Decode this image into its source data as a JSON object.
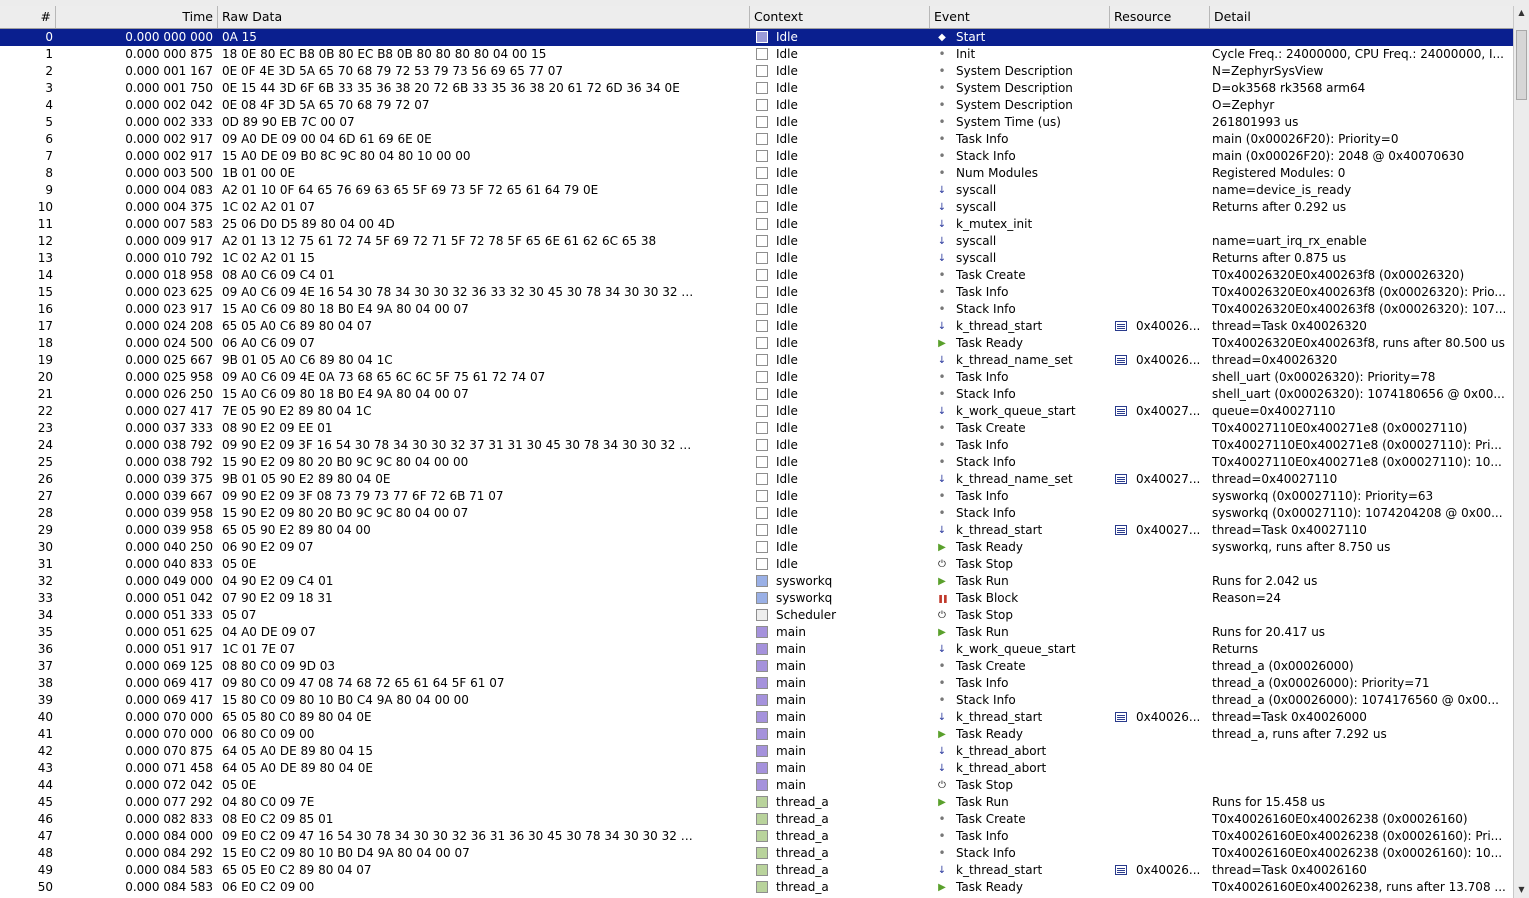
{
  "columns": {
    "num": "#",
    "time": "Time",
    "raw": "Raw Data",
    "context": "Context",
    "event": "Event",
    "resource": "Resource",
    "detail": "Detail"
  },
  "colors": {
    "selected": "#0a1f8f",
    "idle": "#ffffff",
    "scheduler": "#eeeeee",
    "sysworkq": "#9ab0e6",
    "main": "#a592dc",
    "thread_a": "#b9d39c"
  },
  "scroll": {
    "up": "▲",
    "down": "▼"
  },
  "rows": [
    {
      "n": "0",
      "t": "0.000 000 000",
      "r": "0A 15",
      "ctx": "Idle",
      "sw": "#9a9ad8",
      "ev": "Start",
      "ic": "◆",
      "res": "",
      "d": ""
    },
    {
      "n": "1",
      "t": "0.000 000 875",
      "r": "18 0E 80 EC B8 0B 80 EC B8 0B 80 80 80 80 04 00 15",
      "ctx": "Idle",
      "sw": "#ffffff",
      "ev": "Init",
      "ic": "•",
      "res": "",
      "d": "Cycle Freq.: 24000000, CPU Freq.: 24000000, I..."
    },
    {
      "n": "2",
      "t": "0.000 001 167",
      "r": "0E 0F 4E 3D 5A 65 70 68 79 72 53 79 73 56 69 65 77 07",
      "ctx": "Idle",
      "sw": "#ffffff",
      "ev": "System Description",
      "ic": "•",
      "res": "",
      "d": "N=ZephyrSysView"
    },
    {
      "n": "3",
      "t": "0.000 001 750",
      "r": "0E 15 44 3D 6F 6B 33 35 36 38 20 72 6B 33 35 36 38 20 61 72 6D 36 34 0E",
      "ctx": "Idle",
      "sw": "#ffffff",
      "ev": "System Description",
      "ic": "•",
      "res": "",
      "d": "D=ok3568 rk3568 arm64"
    },
    {
      "n": "4",
      "t": "0.000 002 042",
      "r": "0E 08 4F 3D 5A 65 70 68 79 72 07",
      "ctx": "Idle",
      "sw": "#ffffff",
      "ev": "System Description",
      "ic": "•",
      "res": "",
      "d": "O=Zephyr"
    },
    {
      "n": "5",
      "t": "0.000 002 333",
      "r": "0D 89 90 EB 7C 00 07",
      "ctx": "Idle",
      "sw": "#ffffff",
      "ev": "System Time (us)",
      "ic": "•",
      "res": "",
      "d": "261801993 us"
    },
    {
      "n": "6",
      "t": "0.000 002 917",
      "r": "09 A0 DE 09 00 04 6D 61 69 6E 0E",
      "ctx": "Idle",
      "sw": "#ffffff",
      "ev": "Task Info",
      "ic": "•",
      "res": "",
      "d": "main (0x00026F20): Priority=0"
    },
    {
      "n": "7",
      "t": "0.000 002 917",
      "r": "15 A0 DE 09 B0 8C 9C 80 04 80 10 00 00",
      "ctx": "Idle",
      "sw": "#ffffff",
      "ev": "Stack Info",
      "ic": "•",
      "res": "",
      "d": "main (0x00026F20): 2048 @ 0x40070630"
    },
    {
      "n": "8",
      "t": "0.000 003 500",
      "r": "1B 01 00 0E",
      "ctx": "Idle",
      "sw": "#ffffff",
      "ev": "Num Modules",
      "ic": "•",
      "res": "",
      "d": "Registered Modules: 0"
    },
    {
      "n": "9",
      "t": "0.000 004 083",
      "r": "A2 01 10 0F 64 65 76 69 63 65 5F 69 73 5F 72 65 61 64 79 0E",
      "ctx": "Idle",
      "sw": "#ffffff",
      "ev": "syscall",
      "ic": "↓",
      "res": "",
      "d": "name=device_is_ready"
    },
    {
      "n": "10",
      "t": "0.000 004 375",
      "r": "1C 02 A2 01 07",
      "ctx": "Idle",
      "sw": "#ffffff",
      "ev": "syscall",
      "ic": "↓",
      "res": "",
      "d": "Returns after 0.292 us"
    },
    {
      "n": "11",
      "t": "0.000 007 583",
      "r": "25 06 D0 D5 89 80 04 00 4D",
      "ctx": "Idle",
      "sw": "#ffffff",
      "ev": "k_mutex_init",
      "ic": "↓",
      "res": "",
      "d": ""
    },
    {
      "n": "12",
      "t": "0.000 009 917",
      "r": "A2 01 13 12 75 61 72 74 5F 69 72 71 5F 72 78 5F 65 6E 61 62 6C 65 38",
      "ctx": "Idle",
      "sw": "#ffffff",
      "ev": "syscall",
      "ic": "↓",
      "res": "",
      "d": "name=uart_irq_rx_enable"
    },
    {
      "n": "13",
      "t": "0.000 010 792",
      "r": "1C 02 A2 01 15",
      "ctx": "Idle",
      "sw": "#ffffff",
      "ev": "syscall",
      "ic": "↓",
      "res": "",
      "d": "Returns after 0.875 us"
    },
    {
      "n": "14",
      "t": "0.000 018 958",
      "r": "08 A0 C6 09 C4 01",
      "ctx": "Idle",
      "sw": "#ffffff",
      "ev": "Task Create",
      "ic": "•",
      "res": "",
      "d": "T0x40026320E0x400263f8 (0x00026320)"
    },
    {
      "n": "15",
      "t": "0.000 023 625",
      "r": "09 A0 C6 09 4E 16 54 30 78 34 30 30 32 36 33 32 30 45 30 78 34 30 30 32 …",
      "ctx": "Idle",
      "sw": "#ffffff",
      "ev": "Task Info",
      "ic": "•",
      "res": "",
      "d": "T0x40026320E0x400263f8 (0x00026320): Prio..."
    },
    {
      "n": "16",
      "t": "0.000 023 917",
      "r": "15 A0 C6 09 80 18 B0 E4 9A 80 04 00 07",
      "ctx": "Idle",
      "sw": "#ffffff",
      "ev": "Stack Info",
      "ic": "•",
      "res": "",
      "d": "T0x40026320E0x400263f8 (0x00026320): 107..."
    },
    {
      "n": "17",
      "t": "0.000 024 208",
      "r": "65 05 A0 C6 89 80 04 07",
      "ctx": "Idle",
      "sw": "#ffffff",
      "ev": "k_thread_start",
      "ic": "↓",
      "res": "0x40026...",
      "d": "thread=Task 0x40026320"
    },
    {
      "n": "18",
      "t": "0.000 024 500",
      "r": "06 A0 C6 09 07",
      "ctx": "Idle",
      "sw": "#ffffff",
      "ev": "Task Ready",
      "ic": "▶",
      "res": "",
      "d": "T0x40026320E0x400263f8, runs after 80.500 us"
    },
    {
      "n": "19",
      "t": "0.000 025 667",
      "r": "9B 01 05 A0 C6 89 80 04 1C",
      "ctx": "Idle",
      "sw": "#ffffff",
      "ev": "k_thread_name_set",
      "ic": "↓",
      "res": "0x40026...",
      "d": "thread=0x40026320"
    },
    {
      "n": "20",
      "t": "0.000 025 958",
      "r": "09 A0 C6 09 4E 0A 73 68 65 6C 6C 5F 75 61 72 74 07",
      "ctx": "Idle",
      "sw": "#ffffff",
      "ev": "Task Info",
      "ic": "•",
      "res": "",
      "d": "shell_uart (0x00026320): Priority=78"
    },
    {
      "n": "21",
      "t": "0.000 026 250",
      "r": "15 A0 C6 09 80 18 B0 E4 9A 80 04 00 07",
      "ctx": "Idle",
      "sw": "#ffffff",
      "ev": "Stack Info",
      "ic": "•",
      "res": "",
      "d": "shell_uart (0x00026320): 1074180656 @ 0x00..."
    },
    {
      "n": "22",
      "t": "0.000 027 417",
      "r": "7E 05 90 E2 89 80 04 1C",
      "ctx": "Idle",
      "sw": "#ffffff",
      "ev": "k_work_queue_start",
      "ic": "↓",
      "res": "0x40027...",
      "d": "queue=0x40027110"
    },
    {
      "n": "23",
      "t": "0.000 037 333",
      "r": "08 90 E2 09 EE 01",
      "ctx": "Idle",
      "sw": "#ffffff",
      "ev": "Task Create",
      "ic": "•",
      "res": "",
      "d": "T0x40027110E0x400271e8 (0x00027110)"
    },
    {
      "n": "24",
      "t": "0.000 038 792",
      "r": "09 90 E2 09 3F 16 54 30 78 34 30 30 32 37 31 31 30 45 30 78 34 30 30 32 …",
      "ctx": "Idle",
      "sw": "#ffffff",
      "ev": "Task Info",
      "ic": "•",
      "res": "",
      "d": "T0x40027110E0x400271e8 (0x00027110): Pri..."
    },
    {
      "n": "25",
      "t": "0.000 038 792",
      "r": "15 90 E2 09 80 20 B0 9C 9C 80 04 00 00",
      "ctx": "Idle",
      "sw": "#ffffff",
      "ev": "Stack Info",
      "ic": "•",
      "res": "",
      "d": "T0x40027110E0x400271e8 (0x00027110): 10..."
    },
    {
      "n": "26",
      "t": "0.000 039 375",
      "r": "9B 01 05 90 E2 89 80 04 0E",
      "ctx": "Idle",
      "sw": "#ffffff",
      "ev": "k_thread_name_set",
      "ic": "↓",
      "res": "0x40027...",
      "d": "thread=0x40027110"
    },
    {
      "n": "27",
      "t": "0.000 039 667",
      "r": "09 90 E2 09 3F 08 73 79 73 77 6F 72 6B 71 07",
      "ctx": "Idle",
      "sw": "#ffffff",
      "ev": "Task Info",
      "ic": "•",
      "res": "",
      "d": "sysworkq (0x00027110): Priority=63"
    },
    {
      "n": "28",
      "t": "0.000 039 958",
      "r": "15 90 E2 09 80 20 B0 9C 9C 80 04 00 07",
      "ctx": "Idle",
      "sw": "#ffffff",
      "ev": "Stack Info",
      "ic": "•",
      "res": "",
      "d": "sysworkq (0x00027110): 1074204208 @ 0x00..."
    },
    {
      "n": "29",
      "t": "0.000 039 958",
      "r": "65 05 90 E2 89 80 04 00",
      "ctx": "Idle",
      "sw": "#ffffff",
      "ev": "k_thread_start",
      "ic": "↓",
      "res": "0x40027...",
      "d": "thread=Task 0x40027110"
    },
    {
      "n": "30",
      "t": "0.000 040 250",
      "r": "06 90 E2 09 07",
      "ctx": "Idle",
      "sw": "#ffffff",
      "ev": "Task Ready",
      "ic": "▶",
      "res": "",
      "d": "sysworkq, runs after 8.750 us"
    },
    {
      "n": "31",
      "t": "0.000 040 833",
      "r": "05 0E",
      "ctx": "Idle",
      "sw": "#ffffff",
      "ev": "Task Stop",
      "ic": "⏻",
      "res": "",
      "d": ""
    },
    {
      "n": "32",
      "t": "0.000 049 000",
      "r": "04 90 E2 09 C4 01",
      "ctx": "sysworkq",
      "sw": "#9ab0e6",
      "ev": "Task Run",
      "ic": "▶",
      "res": "",
      "d": "Runs for 2.042 us"
    },
    {
      "n": "33",
      "t": "0.000 051 042",
      "r": "07 90 E2 09 18 31",
      "ctx": "sysworkq",
      "sw": "#9ab0e6",
      "ev": "Task Block",
      "ic": "❚❚",
      "res": "",
      "d": "Reason=24"
    },
    {
      "n": "34",
      "t": "0.000 051 333",
      "r": "05 07",
      "ctx": "Scheduler",
      "sw": "#eeeeee",
      "ev": "Task Stop",
      "ic": "⏻",
      "res": "",
      "d": ""
    },
    {
      "n": "35",
      "t": "0.000 051 625",
      "r": "04 A0 DE 09 07",
      "ctx": "main",
      "sw": "#a592dc",
      "ev": "Task Run",
      "ic": "▶",
      "res": "",
      "d": "Runs for 20.417 us"
    },
    {
      "n": "36",
      "t": "0.000 051 917",
      "r": "1C 01 7E 07",
      "ctx": "main",
      "sw": "#a592dc",
      "ev": "k_work_queue_start",
      "ic": "↓",
      "res": "",
      "d": "Returns"
    },
    {
      "n": "37",
      "t": "0.000 069 125",
      "r": "08 80 C0 09 9D 03",
      "ctx": "main",
      "sw": "#a592dc",
      "ev": "Task Create",
      "ic": "•",
      "res": "",
      "d": "thread_a (0x00026000)"
    },
    {
      "n": "38",
      "t": "0.000 069 417",
      "r": "09 80 C0 09 47 08 74 68 72 65 61 64 5F 61 07",
      "ctx": "main",
      "sw": "#a592dc",
      "ev": "Task Info",
      "ic": "•",
      "res": "",
      "d": "thread_a (0x00026000): Priority=71"
    },
    {
      "n": "39",
      "t": "0.000 069 417",
      "r": "15 80 C0 09 80 10 B0 C4 9A 80 04 00 00",
      "ctx": "main",
      "sw": "#a592dc",
      "ev": "Stack Info",
      "ic": "•",
      "res": "",
      "d": "thread_a (0x00026000): 1074176560 @ 0x00..."
    },
    {
      "n": "40",
      "t": "0.000 070 000",
      "r": "65 05 80 C0 89 80 04 0E",
      "ctx": "main",
      "sw": "#a592dc",
      "ev": "k_thread_start",
      "ic": "↓",
      "res": "0x40026...",
      "d": "thread=Task 0x40026000"
    },
    {
      "n": "41",
      "t": "0.000 070 000",
      "r": "06 80 C0 09 00",
      "ctx": "main",
      "sw": "#a592dc",
      "ev": "Task Ready",
      "ic": "▶",
      "res": "",
      "d": "thread_a, runs after 7.292 us"
    },
    {
      "n": "42",
      "t": "0.000 070 875",
      "r": "64 05 A0 DE 89 80 04 15",
      "ctx": "main",
      "sw": "#a592dc",
      "ev": "k_thread_abort",
      "ic": "↓",
      "res": "",
      "d": ""
    },
    {
      "n": "43",
      "t": "0.000 071 458",
      "r": "64 05 A0 DE 89 80 04 0E",
      "ctx": "main",
      "sw": "#a592dc",
      "ev": "k_thread_abort",
      "ic": "↓",
      "res": "",
      "d": ""
    },
    {
      "n": "44",
      "t": "0.000 072 042",
      "r": "05 0E",
      "ctx": "main",
      "sw": "#a592dc",
      "ev": "Task Stop",
      "ic": "⏻",
      "res": "",
      "d": ""
    },
    {
      "n": "45",
      "t": "0.000 077 292",
      "r": "04 80 C0 09 7E",
      "ctx": "thread_a",
      "sw": "#b9d39c",
      "ev": "Task Run",
      "ic": "▶",
      "res": "",
      "d": "Runs for 15.458 us"
    },
    {
      "n": "46",
      "t": "0.000 082 833",
      "r": "08 E0 C2 09 85 01",
      "ctx": "thread_a",
      "sw": "#b9d39c",
      "ev": "Task Create",
      "ic": "•",
      "res": "",
      "d": "T0x40026160E0x40026238 (0x00026160)"
    },
    {
      "n": "47",
      "t": "0.000 084 000",
      "r": "09 E0 C2 09 47 16 54 30 78 34 30 30 32 36 31 36 30 45 30 78 34 30 30 32 …",
      "ctx": "thread_a",
      "sw": "#b9d39c",
      "ev": "Task Info",
      "ic": "•",
      "res": "",
      "d": "T0x40026160E0x40026238 (0x00026160): Pri..."
    },
    {
      "n": "48",
      "t": "0.000 084 292",
      "r": "15 E0 C2 09 80 10 B0 D4 9A 80 04 00 07",
      "ctx": "thread_a",
      "sw": "#b9d39c",
      "ev": "Stack Info",
      "ic": "•",
      "res": "",
      "d": "T0x40026160E0x40026238 (0x00026160): 10..."
    },
    {
      "n": "49",
      "t": "0.000 084 583",
      "r": "65 05 E0 C2 89 80 04 07",
      "ctx": "thread_a",
      "sw": "#b9d39c",
      "ev": "k_thread_start",
      "ic": "↓",
      "res": "0x40026...",
      "d": "thread=Task 0x40026160"
    },
    {
      "n": "50",
      "t": "0.000 084 583",
      "r": "06 E0 C2 09 00",
      "ctx": "thread_a",
      "sw": "#b9d39c",
      "ev": "Task Ready",
      "ic": "▶",
      "res": "",
      "d": "T0x40026160E0x40026238, runs after 13.708 ..."
    }
  ]
}
